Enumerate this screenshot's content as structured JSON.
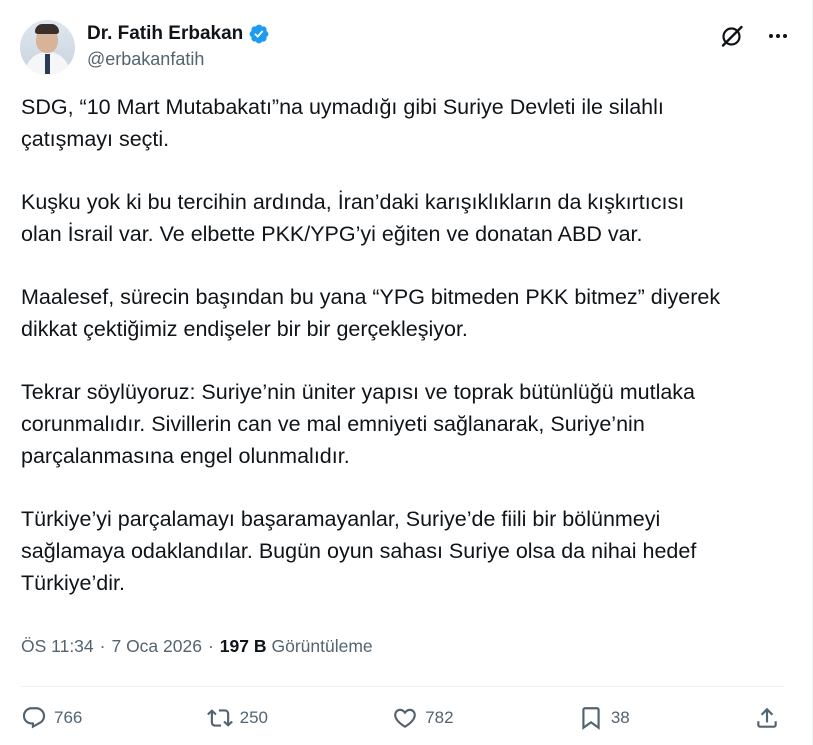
{
  "author": {
    "display_name": "Dr. Fatih Erbakan",
    "handle": "@erbakanfatih",
    "verified_color": "#1d9bf0"
  },
  "header_icons": {
    "grok": "grok-icon",
    "more": "more-icon"
  },
  "tweet": {
    "paragraphs": [
      "SDG, “10 Mart Mutabakatı”na uymadığı gibi Suriye Devleti ile silahlı\nçatışmayı seçti.",
      "Kuşku yok ki bu tercihin ardında, İran’daki karışıklıkların da kışkırtıcısı\nolan İsrail var. Ve elbette PKK/YPG’yi eğiten ve donatan ABD var.",
      "Maalesef, sürecin başından bu yana “YPG bitmeden PKK bitmez” diyerek\ndikkat çektiğimiz endişeler bir bir gerçekleşiyor.",
      "Tekrar söylüyoruz: Suriye’nin üniter yapısı ve toprak bütünlüğü mutlaka\ncorunmalıdır. Sivillerin can ve mal emniyeti sağlanarak, Suriye’nin\nparçalanmasına engel olunmalıdır.",
      "Türkiye’yi parçalamayı başaramayanlar, Suriye’de fiili bir bölünmeyi\nsağlamaya odaklandılar. Bugün oyun sahası Suriye olsa da nihai hedef\nTürkiye’dir."
    ]
  },
  "meta": {
    "time": "ÖS 11:34",
    "separator": "·",
    "date": "7 Oca 2026",
    "views_count": "197 B",
    "views_label": "Görüntüleme"
  },
  "actions": {
    "replies": "766",
    "reposts": "250",
    "likes": "782",
    "bookmarks": "38"
  },
  "colors": {
    "text": "#0f1419",
    "secondary": "#536471",
    "accent": "#1d9bf0",
    "divider": "#eff3f4"
  }
}
